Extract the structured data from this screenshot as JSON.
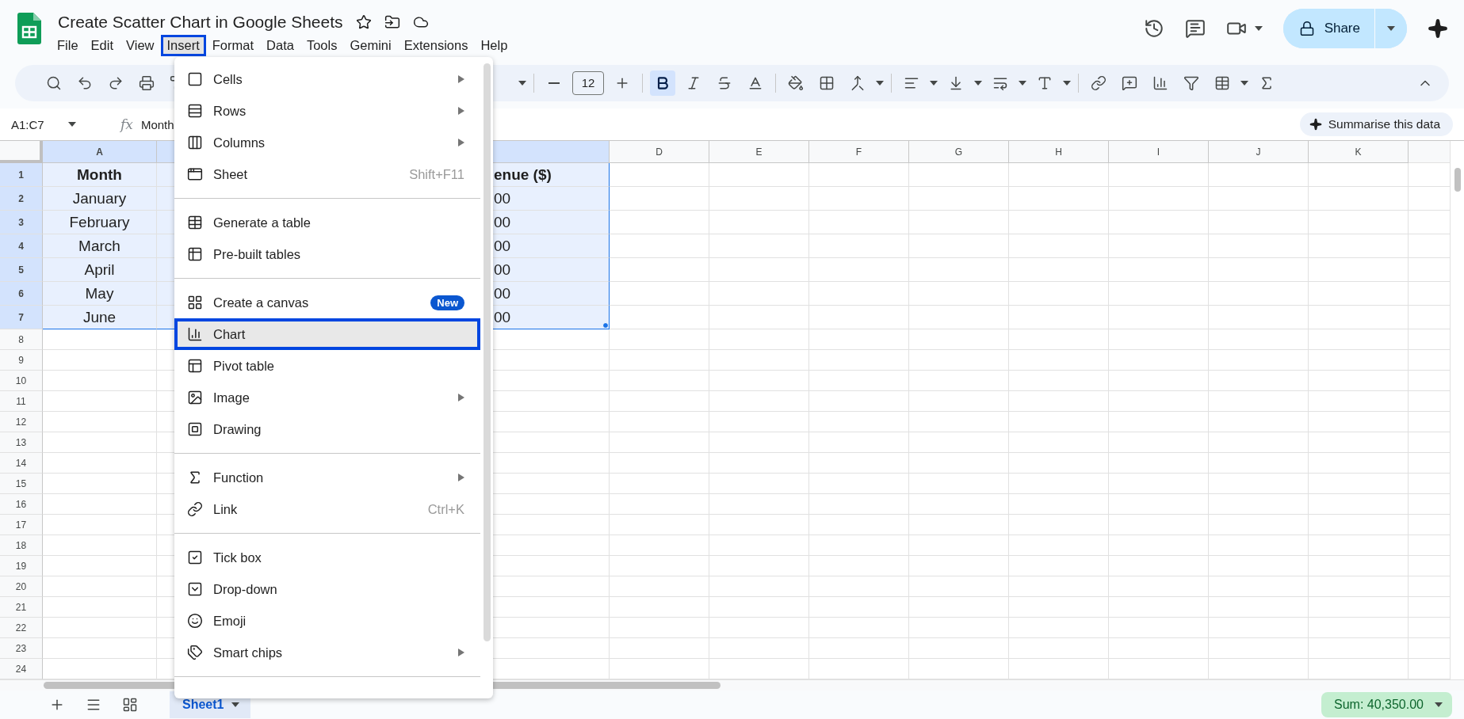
{
  "document": {
    "title": "Create Scatter Chart in Google Sheets"
  },
  "menubar": [
    {
      "label": "File",
      "selected": false
    },
    {
      "label": "Edit",
      "selected": false
    },
    {
      "label": "View",
      "selected": false
    },
    {
      "label": "Insert",
      "selected": true
    },
    {
      "label": "Format",
      "selected": false
    },
    {
      "label": "Data",
      "selected": false
    },
    {
      "label": "Tools",
      "selected": false
    },
    {
      "label": "Gemini",
      "selected": false
    },
    {
      "label": "Extensions",
      "selected": false
    },
    {
      "label": "Help",
      "selected": false
    }
  ],
  "share_button": "Share",
  "toolbar": {
    "font_size": "12",
    "bold": true
  },
  "formula_bar": {
    "name_box": "A1:C7",
    "fx_label": "fx",
    "formula": "Month",
    "summarise_button": "Summarise this data"
  },
  "columns": [
    {
      "label": "A",
      "selected": true
    },
    {
      "selected": true
    },
    {
      "selected": true
    },
    {
      "label": "D",
      "selected": false
    },
    {
      "label": "E",
      "selected": false
    },
    {
      "label": "F",
      "selected": false
    },
    {
      "label": "G",
      "selected": false
    },
    {
      "label": "H",
      "selected": false
    },
    {
      "label": "I",
      "selected": false
    },
    {
      "label": "J",
      "selected": false
    },
    {
      "label": "K",
      "selected": false
    }
  ],
  "rows": [
    {
      "number": "1",
      "selected": true,
      "kind": "header",
      "column_a": "Month",
      "column_c": "enue ($)"
    },
    {
      "number": "2",
      "selected": true,
      "kind": "data",
      "column_a": "January",
      "column_c": "00"
    },
    {
      "number": "3",
      "selected": true,
      "kind": "data",
      "column_a": "February",
      "column_c": "00"
    },
    {
      "number": "4",
      "selected": true,
      "kind": "data",
      "column_a": "March",
      "column_c": "00"
    },
    {
      "number": "5",
      "selected": true,
      "kind": "data",
      "column_a": "April",
      "column_c": "00"
    },
    {
      "number": "6",
      "selected": true,
      "kind": "data",
      "column_a": "May",
      "column_c": "00"
    },
    {
      "number": "7",
      "selected": true,
      "kind": "data",
      "column_a": "June",
      "column_c": "00"
    },
    {
      "number": "8",
      "selected": false,
      "kind": "empty"
    },
    {
      "number": "9",
      "selected": false,
      "kind": "empty"
    },
    {
      "number": "10",
      "selected": false,
      "kind": "empty"
    },
    {
      "number": "11",
      "selected": false,
      "kind": "empty"
    },
    {
      "number": "12",
      "selected": false,
      "kind": "empty"
    },
    {
      "number": "13",
      "selected": false,
      "kind": "empty"
    },
    {
      "number": "14",
      "selected": false,
      "kind": "empty"
    },
    {
      "number": "15",
      "selected": false,
      "kind": "empty"
    },
    {
      "number": "16",
      "selected": false,
      "kind": "empty"
    },
    {
      "number": "17",
      "selected": false,
      "kind": "empty"
    },
    {
      "number": "18",
      "selected": false,
      "kind": "empty"
    },
    {
      "number": "19",
      "selected": false,
      "kind": "empty"
    },
    {
      "number": "20",
      "selected": false,
      "kind": "empty"
    },
    {
      "number": "21",
      "selected": false,
      "kind": "empty"
    },
    {
      "number": "22",
      "selected": false,
      "kind": "empty"
    },
    {
      "number": "23",
      "selected": false,
      "kind": "empty"
    },
    {
      "number": "24",
      "selected": false,
      "kind": "empty"
    }
  ],
  "insert_menu": [
    {
      "kind": "item",
      "label": "Cells",
      "submenu": true,
      "highlighted": false
    },
    {
      "kind": "item",
      "label": "Rows",
      "submenu": true,
      "highlighted": false
    },
    {
      "kind": "item",
      "label": "Columns",
      "submenu": true,
      "highlighted": false
    },
    {
      "kind": "item",
      "label": "Sheet",
      "shortcut": "Shift+F11",
      "submenu": false,
      "highlighted": false
    },
    {
      "kind": "separator"
    },
    {
      "kind": "item",
      "label": "Generate a table",
      "submenu": false,
      "highlighted": false
    },
    {
      "kind": "item",
      "label": "Pre-built tables",
      "submenu": false,
      "highlighted": false
    },
    {
      "kind": "separator"
    },
    {
      "kind": "item",
      "label": "Create a canvas",
      "badge": "New",
      "submenu": false,
      "highlighted": false
    },
    {
      "kind": "item",
      "label": "Chart",
      "submenu": false,
      "highlighted": true
    },
    {
      "kind": "item",
      "label": "Pivot table",
      "submenu": false,
      "highlighted": false
    },
    {
      "kind": "item",
      "label": "Image",
      "submenu": true,
      "highlighted": false
    },
    {
      "kind": "item",
      "label": "Drawing",
      "submenu": false,
      "highlighted": false
    },
    {
      "kind": "separator"
    },
    {
      "kind": "item",
      "label": "Function",
      "submenu": true,
      "highlighted": false
    },
    {
      "kind": "item",
      "label": "Link",
      "shortcut": "Ctrl+K",
      "submenu": false,
      "highlighted": false
    },
    {
      "kind": "separator"
    },
    {
      "kind": "item",
      "label": "Tick box",
      "submenu": false,
      "highlighted": false
    },
    {
      "kind": "item",
      "label": "Drop-down",
      "submenu": false,
      "highlighted": false
    },
    {
      "kind": "item",
      "label": "Emoji",
      "submenu": false,
      "highlighted": false
    },
    {
      "kind": "item",
      "label": "Smart chips",
      "submenu": true,
      "highlighted": false
    },
    {
      "kind": "separator"
    }
  ],
  "sheet_tabs": [
    {
      "label": "Sheet1",
      "selected": true
    }
  ],
  "status": {
    "sum": "Sum: 40,350.00"
  }
}
